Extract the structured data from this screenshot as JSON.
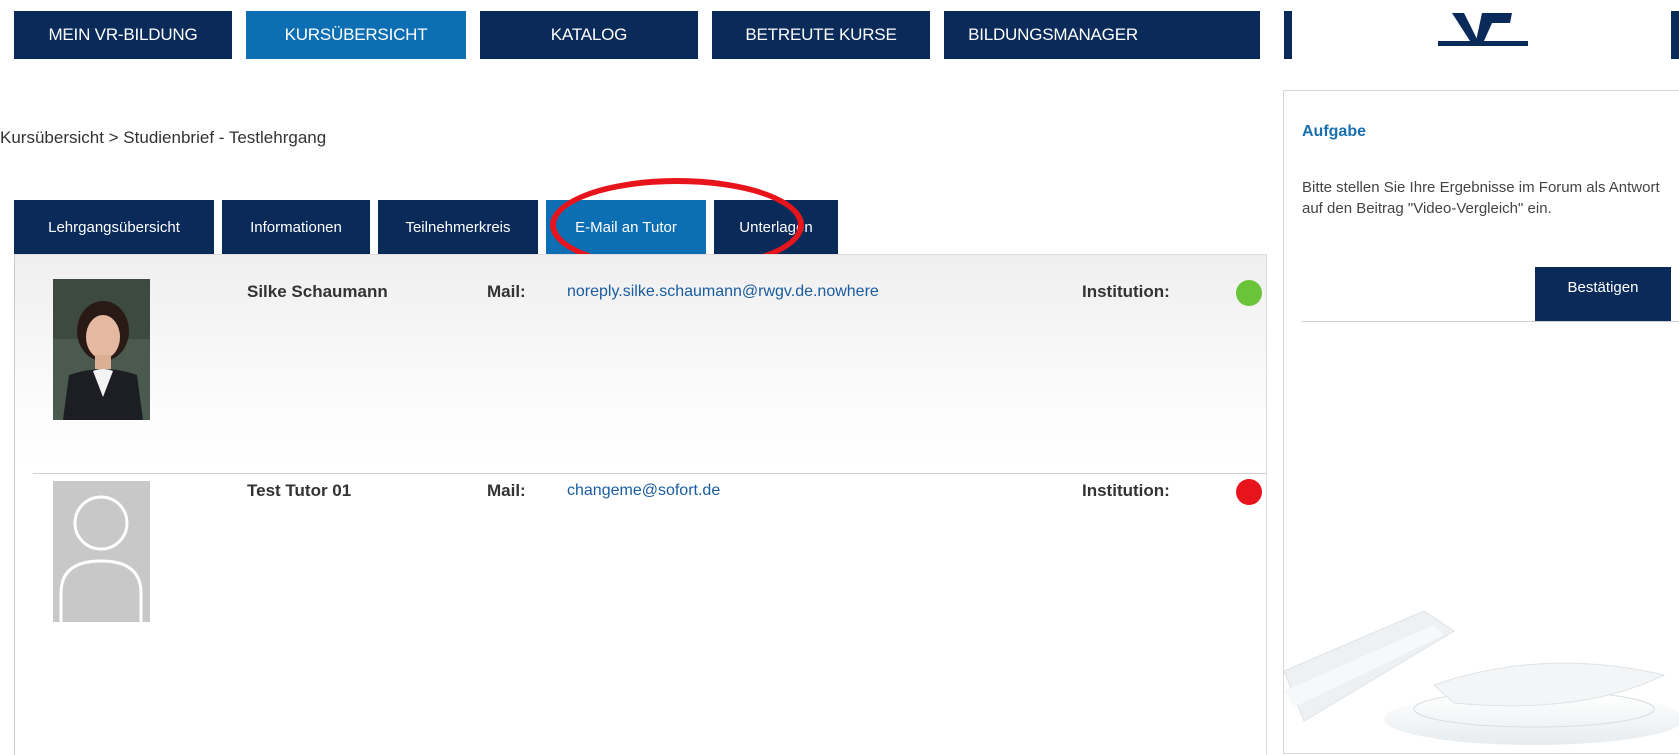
{
  "topnav": {
    "items": [
      {
        "label": "MEIN VR-BILDUNG",
        "active": false
      },
      {
        "label": "KURSÜBERSICHT",
        "active": true
      },
      {
        "label": "KATALOG",
        "active": false
      },
      {
        "label": "BETREUTE KURSE",
        "active": false
      },
      {
        "label": "BILDUNGSMANAGER",
        "active": false
      }
    ],
    "logo_icon": "volksbank-logo-icon"
  },
  "breadcrumb": {
    "text": "Kursübersicht > Studienbrief - Testlehrgang"
  },
  "tabs": [
    {
      "label": "Lehrgangsübersicht",
      "active": false
    },
    {
      "label": "Informationen",
      "active": false
    },
    {
      "label": "Teilnehmerkreis",
      "active": false
    },
    {
      "label": "E-Mail an Tutor",
      "active": true
    },
    {
      "label": "Unterlagen",
      "active": false
    }
  ],
  "tutors": [
    {
      "name": "Silke Schaumann",
      "mail_label": "Mail:",
      "mail": "noreply.silke.schaumann@rwgv.de.nowhere",
      "institution_label": "Institution:",
      "status_color": "#6ac43a",
      "avatar_icon": "person-photo-icon"
    },
    {
      "name": "Test Tutor 01",
      "mail_label": "Mail:",
      "mail": "changeme@sofort.de",
      "institution_label": "Institution:",
      "status_color": "#e8141c",
      "avatar_icon": "default-avatar-icon"
    }
  ],
  "sidebar": {
    "heading": "Aufgabe",
    "text": "Bitte stellen Sie Ihre Ergebnisse im Forum als Antwort auf den Beitrag \"Video-Vergleich\" ein.",
    "confirm_label": "Bestätigen"
  },
  "colors": {
    "nav_dark": "#0a2a5a",
    "nav_active": "#0c6eb3",
    "highlight": "#e8141c",
    "link": "#1a5ca0",
    "heading": "#1a6fb0"
  }
}
